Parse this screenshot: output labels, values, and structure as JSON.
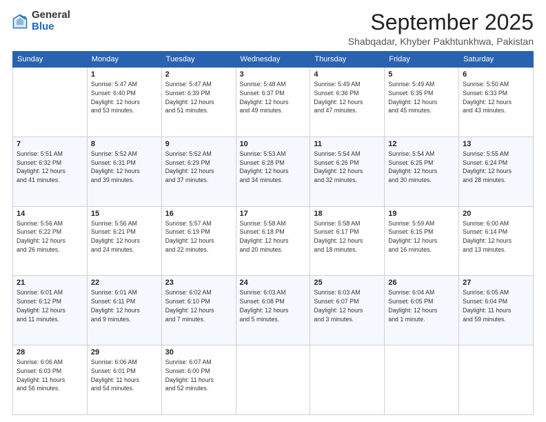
{
  "logo": {
    "general": "General",
    "blue": "Blue"
  },
  "header": {
    "month": "September 2025",
    "location": "Shabqadar, Khyber Pakhtunkhwa, Pakistan"
  },
  "days_of_week": [
    "Sunday",
    "Monday",
    "Tuesday",
    "Wednesday",
    "Thursday",
    "Friday",
    "Saturday"
  ],
  "weeks": [
    [
      {
        "day": "",
        "info": ""
      },
      {
        "day": "1",
        "info": "Sunrise: 5:47 AM\nSunset: 6:40 PM\nDaylight: 12 hours\nand 53 minutes."
      },
      {
        "day": "2",
        "info": "Sunrise: 5:47 AM\nSunset: 6:39 PM\nDaylight: 12 hours\nand 51 minutes."
      },
      {
        "day": "3",
        "info": "Sunrise: 5:48 AM\nSunset: 6:37 PM\nDaylight: 12 hours\nand 49 minutes."
      },
      {
        "day": "4",
        "info": "Sunrise: 5:49 AM\nSunset: 6:36 PM\nDaylight: 12 hours\nand 47 minutes."
      },
      {
        "day": "5",
        "info": "Sunrise: 5:49 AM\nSunset: 6:35 PM\nDaylight: 12 hours\nand 45 minutes."
      },
      {
        "day": "6",
        "info": "Sunrise: 5:50 AM\nSunset: 6:33 PM\nDaylight: 12 hours\nand 43 minutes."
      }
    ],
    [
      {
        "day": "7",
        "info": "Sunrise: 5:51 AM\nSunset: 6:32 PM\nDaylight: 12 hours\nand 41 minutes."
      },
      {
        "day": "8",
        "info": "Sunrise: 5:52 AM\nSunset: 6:31 PM\nDaylight: 12 hours\nand 39 minutes."
      },
      {
        "day": "9",
        "info": "Sunrise: 5:52 AM\nSunset: 6:29 PM\nDaylight: 12 hours\nand 37 minutes."
      },
      {
        "day": "10",
        "info": "Sunrise: 5:53 AM\nSunset: 6:28 PM\nDaylight: 12 hours\nand 34 minutes."
      },
      {
        "day": "11",
        "info": "Sunrise: 5:54 AM\nSunset: 6:26 PM\nDaylight: 12 hours\nand 32 minutes."
      },
      {
        "day": "12",
        "info": "Sunrise: 5:54 AM\nSunset: 6:25 PM\nDaylight: 12 hours\nand 30 minutes."
      },
      {
        "day": "13",
        "info": "Sunrise: 5:55 AM\nSunset: 6:24 PM\nDaylight: 12 hours\nand 28 minutes."
      }
    ],
    [
      {
        "day": "14",
        "info": "Sunrise: 5:56 AM\nSunset: 6:22 PM\nDaylight: 12 hours\nand 26 minutes."
      },
      {
        "day": "15",
        "info": "Sunrise: 5:56 AM\nSunset: 6:21 PM\nDaylight: 12 hours\nand 24 minutes."
      },
      {
        "day": "16",
        "info": "Sunrise: 5:57 AM\nSunset: 6:19 PM\nDaylight: 12 hours\nand 22 minutes."
      },
      {
        "day": "17",
        "info": "Sunrise: 5:58 AM\nSunset: 6:18 PM\nDaylight: 12 hours\nand 20 minutes."
      },
      {
        "day": "18",
        "info": "Sunrise: 5:58 AM\nSunset: 6:17 PM\nDaylight: 12 hours\nand 18 minutes."
      },
      {
        "day": "19",
        "info": "Sunrise: 5:59 AM\nSunset: 6:15 PM\nDaylight: 12 hours\nand 16 minutes."
      },
      {
        "day": "20",
        "info": "Sunrise: 6:00 AM\nSunset: 6:14 PM\nDaylight: 12 hours\nand 13 minutes."
      }
    ],
    [
      {
        "day": "21",
        "info": "Sunrise: 6:01 AM\nSunset: 6:12 PM\nDaylight: 12 hours\nand 11 minutes."
      },
      {
        "day": "22",
        "info": "Sunrise: 6:01 AM\nSunset: 6:11 PM\nDaylight: 12 hours\nand 9 minutes."
      },
      {
        "day": "23",
        "info": "Sunrise: 6:02 AM\nSunset: 6:10 PM\nDaylight: 12 hours\nand 7 minutes."
      },
      {
        "day": "24",
        "info": "Sunrise: 6:03 AM\nSunset: 6:08 PM\nDaylight: 12 hours\nand 5 minutes."
      },
      {
        "day": "25",
        "info": "Sunrise: 6:03 AM\nSunset: 6:07 PM\nDaylight: 12 hours\nand 3 minutes."
      },
      {
        "day": "26",
        "info": "Sunrise: 6:04 AM\nSunset: 6:05 PM\nDaylight: 12 hours\nand 1 minute."
      },
      {
        "day": "27",
        "info": "Sunrise: 6:05 AM\nSunset: 6:04 PM\nDaylight: 11 hours\nand 59 minutes."
      }
    ],
    [
      {
        "day": "28",
        "info": "Sunrise: 6:06 AM\nSunset: 6:03 PM\nDaylight: 11 hours\nand 56 minutes."
      },
      {
        "day": "29",
        "info": "Sunrise: 6:06 AM\nSunset: 6:01 PM\nDaylight: 11 hours\nand 54 minutes."
      },
      {
        "day": "30",
        "info": "Sunrise: 6:07 AM\nSunset: 6:00 PM\nDaylight: 11 hours\nand 52 minutes."
      },
      {
        "day": "",
        "info": ""
      },
      {
        "day": "",
        "info": ""
      },
      {
        "day": "",
        "info": ""
      },
      {
        "day": "",
        "info": ""
      }
    ]
  ]
}
